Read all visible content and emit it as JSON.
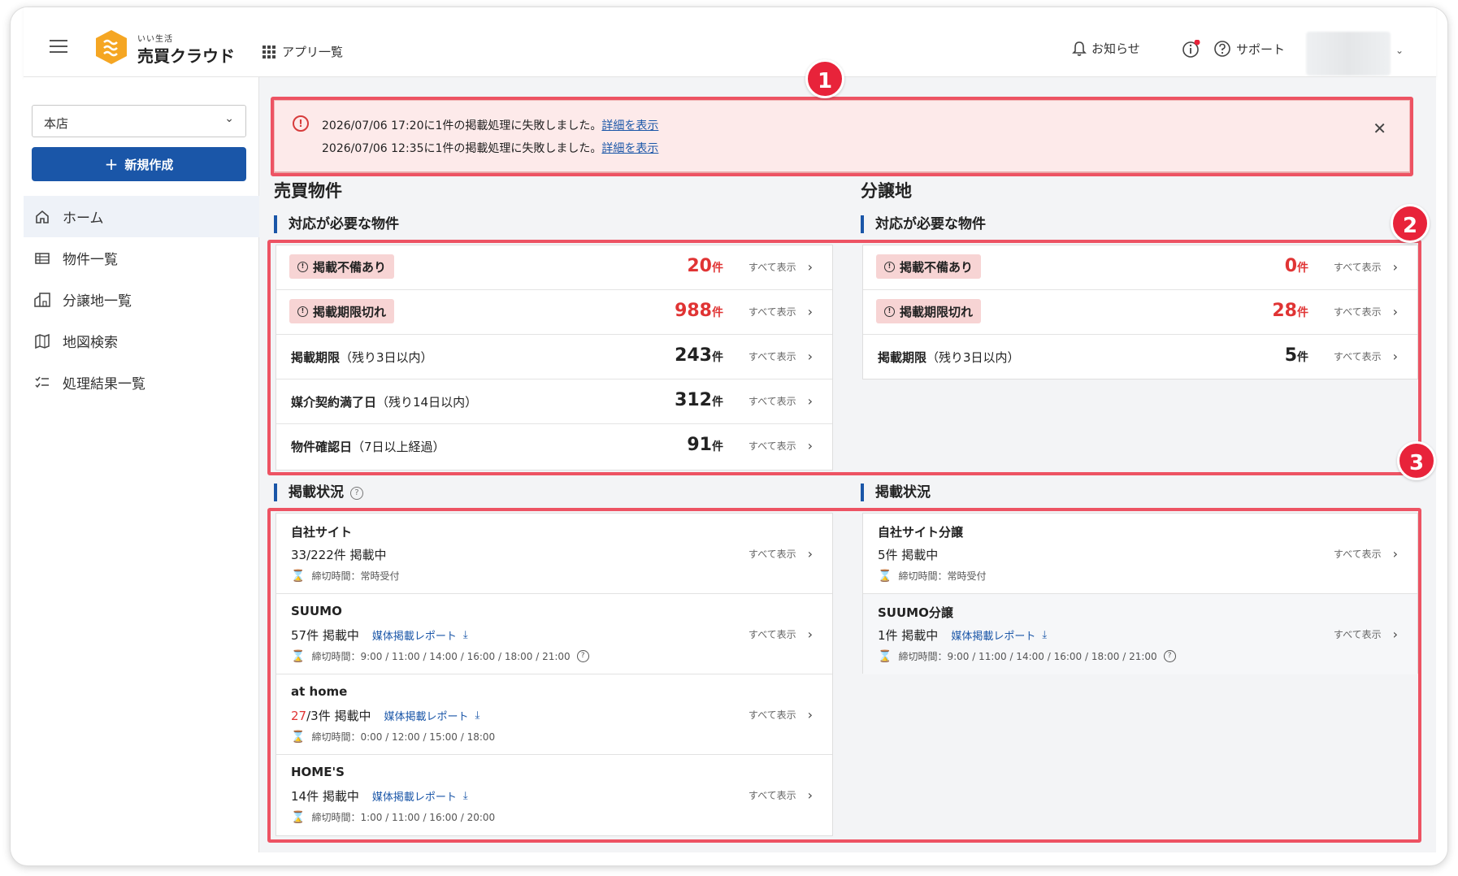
{
  "header": {
    "logo_sub": "いい生活",
    "logo_main": "売買クラウド",
    "apps_label": "アプリ一覧",
    "notice_label": "お知らせ",
    "support_label": "サポート"
  },
  "sidebar": {
    "store_value": "本店",
    "new_button": "新規作成",
    "items": [
      {
        "label": "ホーム",
        "icon": "home-icon"
      },
      {
        "label": "物件一覧",
        "icon": "list-icon"
      },
      {
        "label": "分譲地一覧",
        "icon": "building-icon"
      },
      {
        "label": "地図検索",
        "icon": "map-icon"
      },
      {
        "label": "処理結果一覧",
        "icon": "checklist-icon"
      }
    ]
  },
  "alert": {
    "line1": "2026/07/06 17:20に1件の掲載処理に失敗しました。",
    "line2": "2026/07/06 12:35に1件の掲載処理に失敗しました。",
    "link": "詳細を表示"
  },
  "sales": {
    "title": "売買物件",
    "action_title": "対応が必要な物件",
    "rows": [
      {
        "label": "掲載不備あり",
        "paren": "",
        "count": "20",
        "unit": "件"
      },
      {
        "label": "掲載期限切れ",
        "paren": "",
        "count": "988",
        "unit": "件"
      },
      {
        "label": "掲載期限",
        "paren": "（残り3日以内）",
        "count": "243",
        "unit": "件"
      },
      {
        "label": "媒介契約満了日",
        "paren": "（残り14日以内）",
        "count": "312",
        "unit": "件"
      },
      {
        "label": "物件確認日",
        "paren": "（7日以上経過）",
        "count": "91",
        "unit": "件"
      }
    ],
    "listing_title": "掲載状況",
    "portals": [
      {
        "name": "自社サイト",
        "count_red": "",
        "count": "33/222件 掲載中",
        "report": "",
        "deadline": "締切時間：常時受付"
      },
      {
        "name": "SUUMO",
        "count_red": "",
        "count": "57件 掲載中",
        "report": "媒体掲載レポート",
        "deadline": "締切時間：9:00 / 11:00 / 14:00 / 16:00 / 18:00 / 21:00"
      },
      {
        "name": "at home",
        "count_red": "27",
        "count": "/3件 掲載中",
        "report": "媒体掲載レポート",
        "deadline": "締切時間：0:00 / 12:00 / 15:00 / 18:00"
      },
      {
        "name": "HOME'S",
        "count_red": "",
        "count": "14件 掲載中",
        "report": "媒体掲載レポート",
        "deadline": "締切時間：1:00 / 11:00 / 16:00 / 20:00"
      }
    ]
  },
  "lots": {
    "title": "分譲地",
    "action_title": "対応が必要な物件",
    "rows": [
      {
        "label": "掲載不備あり",
        "paren": "",
        "count": "0",
        "unit": "件"
      },
      {
        "label": "掲載期限切れ",
        "paren": "",
        "count": "28",
        "unit": "件"
      },
      {
        "label": "掲載期限",
        "paren": "（残り3日以内）",
        "count": "5",
        "unit": "件"
      }
    ],
    "listing_title": "掲載状況",
    "portals": [
      {
        "name": "自社サイト分譲",
        "count": "5件 掲載中",
        "report": "",
        "deadline": "締切時間：常時受付"
      },
      {
        "name": "SUUMO分譲",
        "count": "1件 掲載中",
        "report": "媒体掲載レポート",
        "deadline": "締切時間：9:00 / 11:00 / 14:00 / 16:00 / 18:00 / 21:00"
      }
    ]
  },
  "common": {
    "view_all": "すべて表示"
  },
  "callouts": [
    "1",
    "2",
    "3"
  ],
  "colors": {
    "brand": "#1a56a8",
    "alert_red": "#e03434",
    "callout": "#e8233a",
    "logo": "#f5a623"
  }
}
